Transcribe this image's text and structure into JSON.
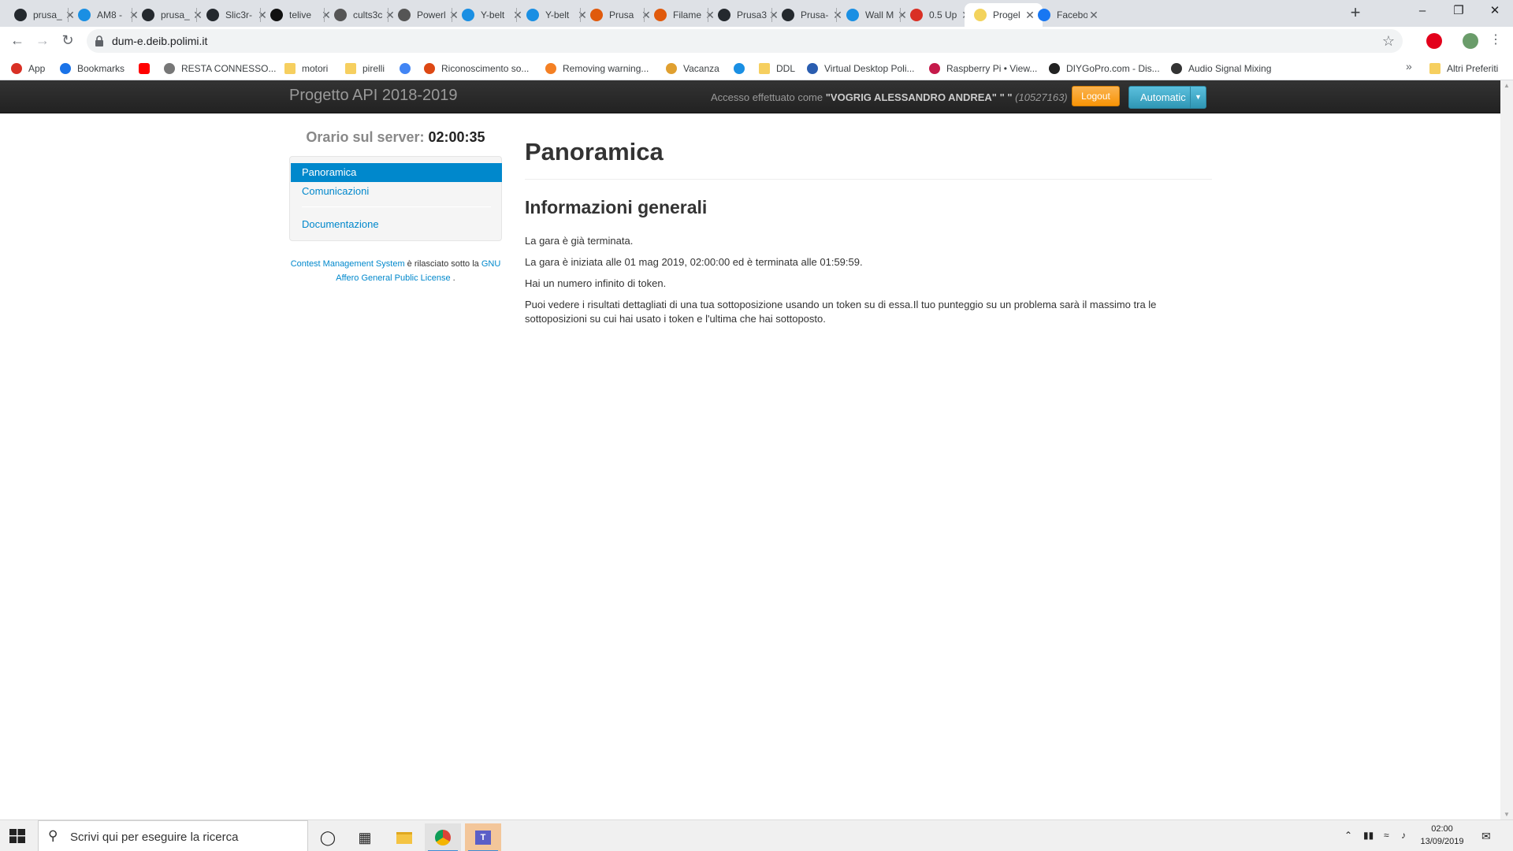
{
  "browser": {
    "tabs": [
      {
        "title": "prusa_",
        "icon": "github-icon",
        "color": "#24292e"
      },
      {
        "title": "AM8 -",
        "icon": "thingiverse-icon",
        "color": "#1a8fe3"
      },
      {
        "title": "prusa_",
        "icon": "github-icon",
        "color": "#24292e"
      },
      {
        "title": "Slic3r-",
        "icon": "github-icon",
        "color": "#24292e"
      },
      {
        "title": "telive",
        "icon": "rtl-icon",
        "color": "#111111"
      },
      {
        "title": "cults3c",
        "icon": "globe-icon",
        "color": "#555555"
      },
      {
        "title": "Powerl",
        "icon": "globe-icon",
        "color": "#555555"
      },
      {
        "title": "Y-belt",
        "icon": "thingiverse-icon",
        "color": "#1a8fe3"
      },
      {
        "title": "Y-belt",
        "icon": "thingiverse-icon",
        "color": "#1a8fe3"
      },
      {
        "title": "Prusa",
        "icon": "prusa-icon",
        "color": "#e05a0c"
      },
      {
        "title": "Filame",
        "icon": "prusa-icon",
        "color": "#e05a0c"
      },
      {
        "title": "Prusa3",
        "icon": "github-icon",
        "color": "#24292e"
      },
      {
        "title": "Prusa-",
        "icon": "github-icon",
        "color": "#24292e"
      },
      {
        "title": "Wall M",
        "icon": "thingiverse-icon",
        "color": "#1a8fe3"
      },
      {
        "title": "0.5 Up",
        "icon": "d-icon",
        "color": "#d93025"
      },
      {
        "title": "Progel",
        "icon": "loading-icon",
        "color": "#f3d35c"
      },
      {
        "title": "Facebo",
        "icon": "facebook-icon",
        "color": "#1877f2"
      }
    ],
    "active_tab": 15,
    "url": "dum-e.deib.polimi.it",
    "bookmarks": [
      {
        "label": "App",
        "icon": "apps-grid-icon"
      },
      {
        "label": "Bookmarks",
        "icon": "star-icon"
      },
      {
        "label": "",
        "icon": "youtube-icon"
      },
      {
        "label": "RESTA CONNESSO...",
        "icon": "resta-icon"
      },
      {
        "label": "motori",
        "icon": "folder-icon"
      },
      {
        "label": "pirelli",
        "icon": "folder-icon"
      },
      {
        "label": "",
        "icon": "google-icon"
      },
      {
        "label": "Riconoscimento so...",
        "icon": "ubuntu-icon"
      },
      {
        "label": "Removing warning...",
        "icon": "stackoverflow-icon"
      },
      {
        "label": "Vacanza",
        "icon": "sun-icon"
      },
      {
        "label": "",
        "icon": "thingiverse-icon"
      },
      {
        "label": "DDL",
        "icon": "folder-icon"
      },
      {
        "label": "Virtual Desktop Poli...",
        "icon": "vdi-icon"
      },
      {
        "label": "Raspberry Pi • View...",
        "icon": "raspberry-icon"
      },
      {
        "label": "DIYGoPro.com - Dis...",
        "icon": "diygopro-icon"
      },
      {
        "label": "Audio Signal Mixing",
        "icon": "mixing-icon"
      }
    ],
    "more_bookmarks": "»",
    "other_bookmarks": "Altri Preferiti"
  },
  "cms": {
    "brand": "Progetto API 2018-2019",
    "login_prefix": "Accesso effettuato come",
    "login_name": "\"VOGRIG ALESSANDRO ANDREA\" \" \"",
    "login_id": "(10527163)",
    "logout_label": "Logout",
    "lang_label": "Automatic",
    "server_time_label": "Orario sul server:",
    "server_time": "02:00:35",
    "nav": {
      "overview": "Panoramica",
      "communications": "Comunicazioni",
      "documentation": "Documentazione"
    },
    "license": {
      "link1": "Contest Management System",
      "mid": " è rilasciato sotto la ",
      "link2": "GNU Affero General Public License",
      "end": "."
    }
  },
  "main": {
    "title": "Panoramica",
    "subtitle": "Informazioni generali",
    "p1": "La gara è già terminata.",
    "p2": "La gara è iniziata alle 01 mag 2019, 02:00:00 ed è terminata alle 01:59:59.",
    "p3": "Hai un numero infinito di token.",
    "p4": "Puoi vedere i risultati dettagliati di una tua sottoposizione usando un token su di essa.Il tuo punteggio su un problema sarà il massimo tra le sottoposizioni su cui hai usato i token e l'ultima che hai sottoposto."
  },
  "taskbar": {
    "search_placeholder": "Scrivi qui per eseguire la ricerca",
    "time": "02:00",
    "date": "13/09/2019"
  }
}
